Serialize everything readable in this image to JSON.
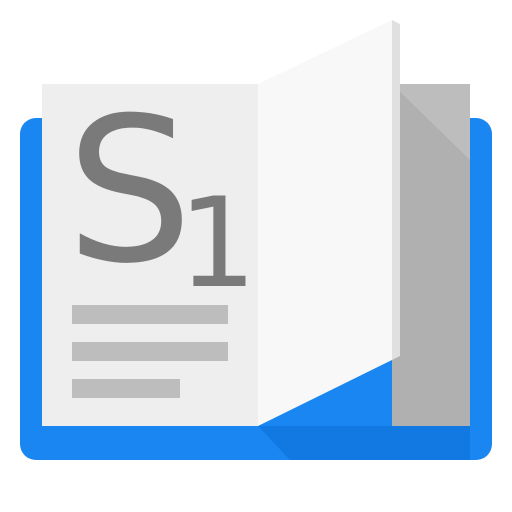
{
  "app_icon": {
    "monogram_letter": "S",
    "monogram_digit": "1",
    "colors": {
      "cover": "#1a86f2",
      "cover_shadow": "#0d6fd6",
      "page_left": "#eeeeee",
      "page_right": "#f8f8f8",
      "page_back": "#bdbdbd",
      "text_lines": "#bdbdbd",
      "monogram": "#7a7a7a"
    }
  }
}
